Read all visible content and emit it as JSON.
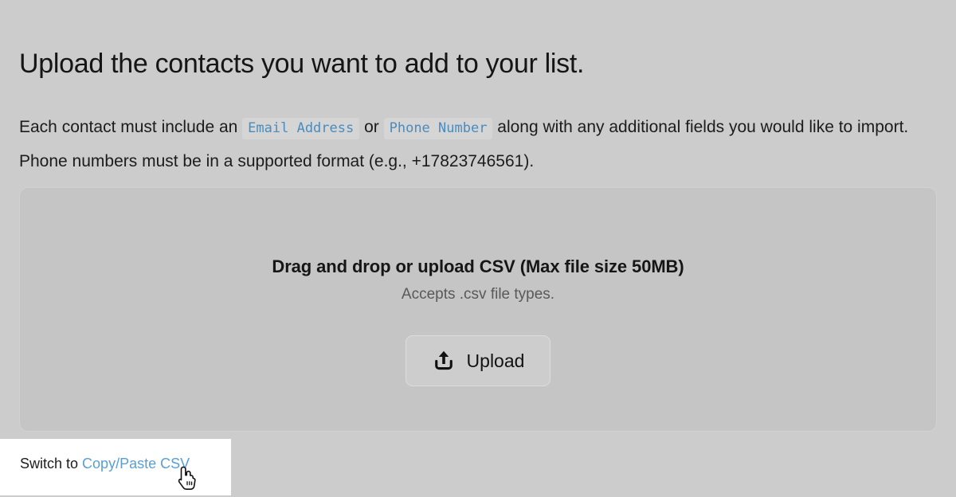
{
  "heading": "Upload the contacts you want to add to your list.",
  "intro": {
    "part1": "Each contact must include an",
    "chip1": "Email Address",
    "part2": "or",
    "chip2": "Phone Number",
    "part3": "along with any additional fields you would like to import. Phone numbers must be in a supported format (e.g., +17823746561)."
  },
  "dropzone": {
    "title": "Drag and drop or upload CSV (Max file size 50MB)",
    "subtitle": "Accepts .csv file types.",
    "upload_label": "Upload",
    "upload_icon": "upload-tray-icon"
  },
  "footer": {
    "switch_prefix": "Switch to",
    "switch_link": "Copy/Paste CSV",
    "cursor_icon": "pointing-hand-cursor"
  },
  "colors": {
    "page_background": "#cccccc",
    "dropzone_background": "#c5c5c5",
    "dropzone_border": "#d2d2d2",
    "chip_background": "#d5d5d5",
    "chip_text": "#4a8cbe",
    "link": "#5a9fd4",
    "panel_background": "#ffffff",
    "subtitle_text": "#595959"
  }
}
